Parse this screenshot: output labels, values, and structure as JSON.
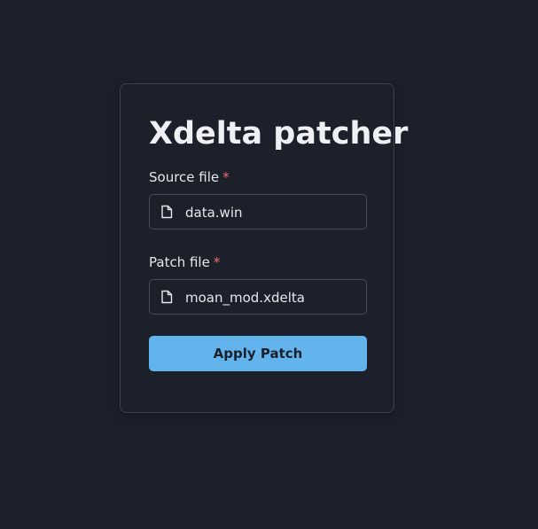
{
  "card": {
    "title": "Xdelta patcher"
  },
  "source": {
    "label": "Source file",
    "required_marker": "*",
    "file_name": "data.win"
  },
  "patch": {
    "label": "Patch file",
    "required_marker": "*",
    "file_name": "moan_mod.xdelta"
  },
  "apply_button": {
    "label": "Apply Patch"
  },
  "icons": {
    "file": "file-icon"
  },
  "colors": {
    "background": "#1b202b",
    "accent": "#63b3ed",
    "required": "#f26d6d"
  }
}
